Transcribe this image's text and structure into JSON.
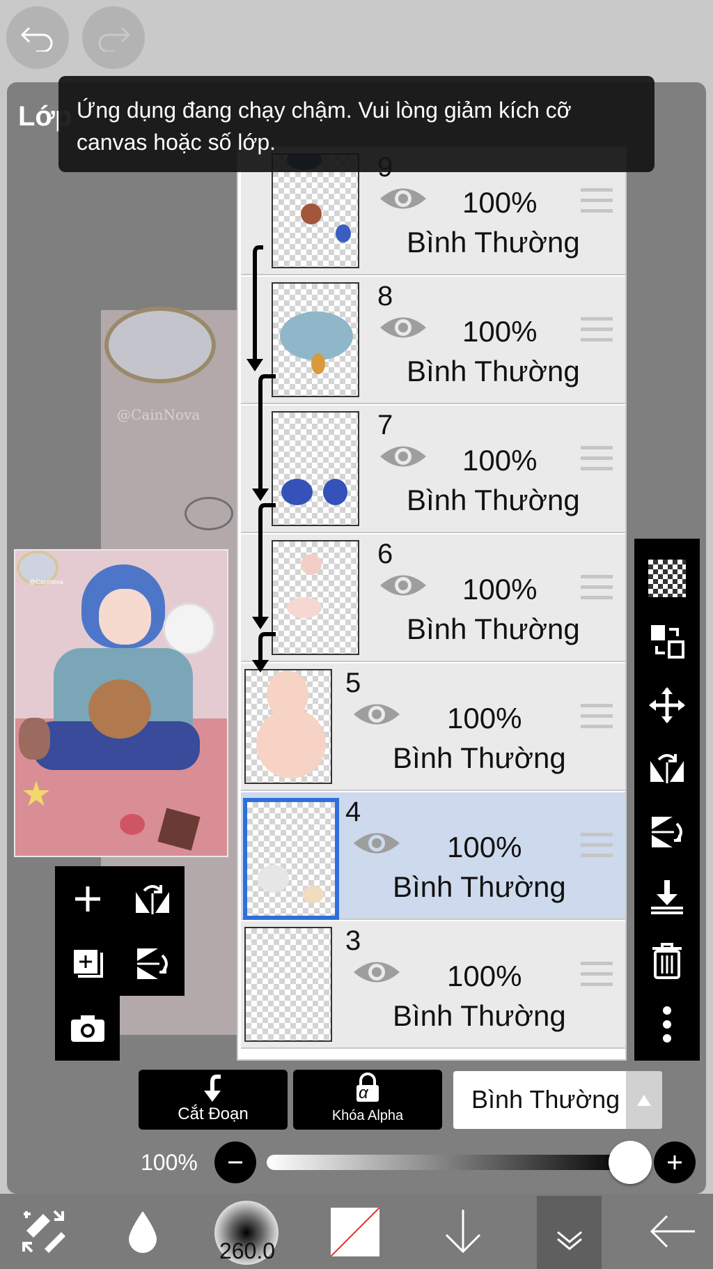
{
  "toast": {
    "message": "Ứng dụng đang chạy chậm. Vui lòng giảm kích cỡ canvas hoặc số lớp."
  },
  "panel": {
    "title": "Lớp"
  },
  "canvas": {
    "watermark": "@CainNova"
  },
  "preview": {
    "watermark": "@CainNova"
  },
  "layers": [
    {
      "number": "9",
      "opacity": "100%",
      "blend": "Bình Thường",
      "clipped": true,
      "selected": false
    },
    {
      "number": "8",
      "opacity": "100%",
      "blend": "Bình Thường",
      "clipped": true,
      "selected": false
    },
    {
      "number": "7",
      "opacity": "100%",
      "blend": "Bình Thường",
      "clipped": true,
      "selected": false
    },
    {
      "number": "6",
      "opacity": "100%",
      "blend": "Bình Thường",
      "clipped": true,
      "selected": false
    },
    {
      "number": "5",
      "opacity": "100%",
      "blend": "Bình Thường",
      "clipped": false,
      "selected": false
    },
    {
      "number": "4",
      "opacity": "100%",
      "blend": "Bình Thường",
      "clipped": false,
      "selected": true
    },
    {
      "number": "3",
      "opacity": "100%",
      "blend": "Bình Thường",
      "clipped": false,
      "selected": false
    }
  ],
  "buttons": {
    "clipping": "Cắt Đoạn",
    "alpha_lock": "Khóa Alpha",
    "alpha_symbol": "α"
  },
  "blend_mode": {
    "selected": "Bình Thường"
  },
  "opacity": {
    "label": "100%",
    "value": 1.0
  },
  "brush": {
    "size": "260.0"
  },
  "colors": {
    "selection": "#2f6fdd",
    "selected_row": "#cdd9ec",
    "row": "#eaeaea"
  },
  "icons": {
    "top": [
      "undo-icon",
      "redo-icon"
    ],
    "left": [
      "add-layer-icon",
      "flip-horizontal-icon",
      "add-copy-icon",
      "flip-vertical-icon",
      "camera-icon"
    ],
    "right": [
      "transparency-icon",
      "layer-swap-icon",
      "move-icon",
      "flip-horizontal-icon",
      "flip-vertical-icon",
      "merge-down-icon",
      "trash-icon",
      "more-icon"
    ],
    "bottom": [
      "transform-tool-icon",
      "drop-icon",
      "brush-size-icon",
      "color-icon",
      "down-arrow-icon",
      "layer-panel-icon",
      "back-icon"
    ]
  }
}
